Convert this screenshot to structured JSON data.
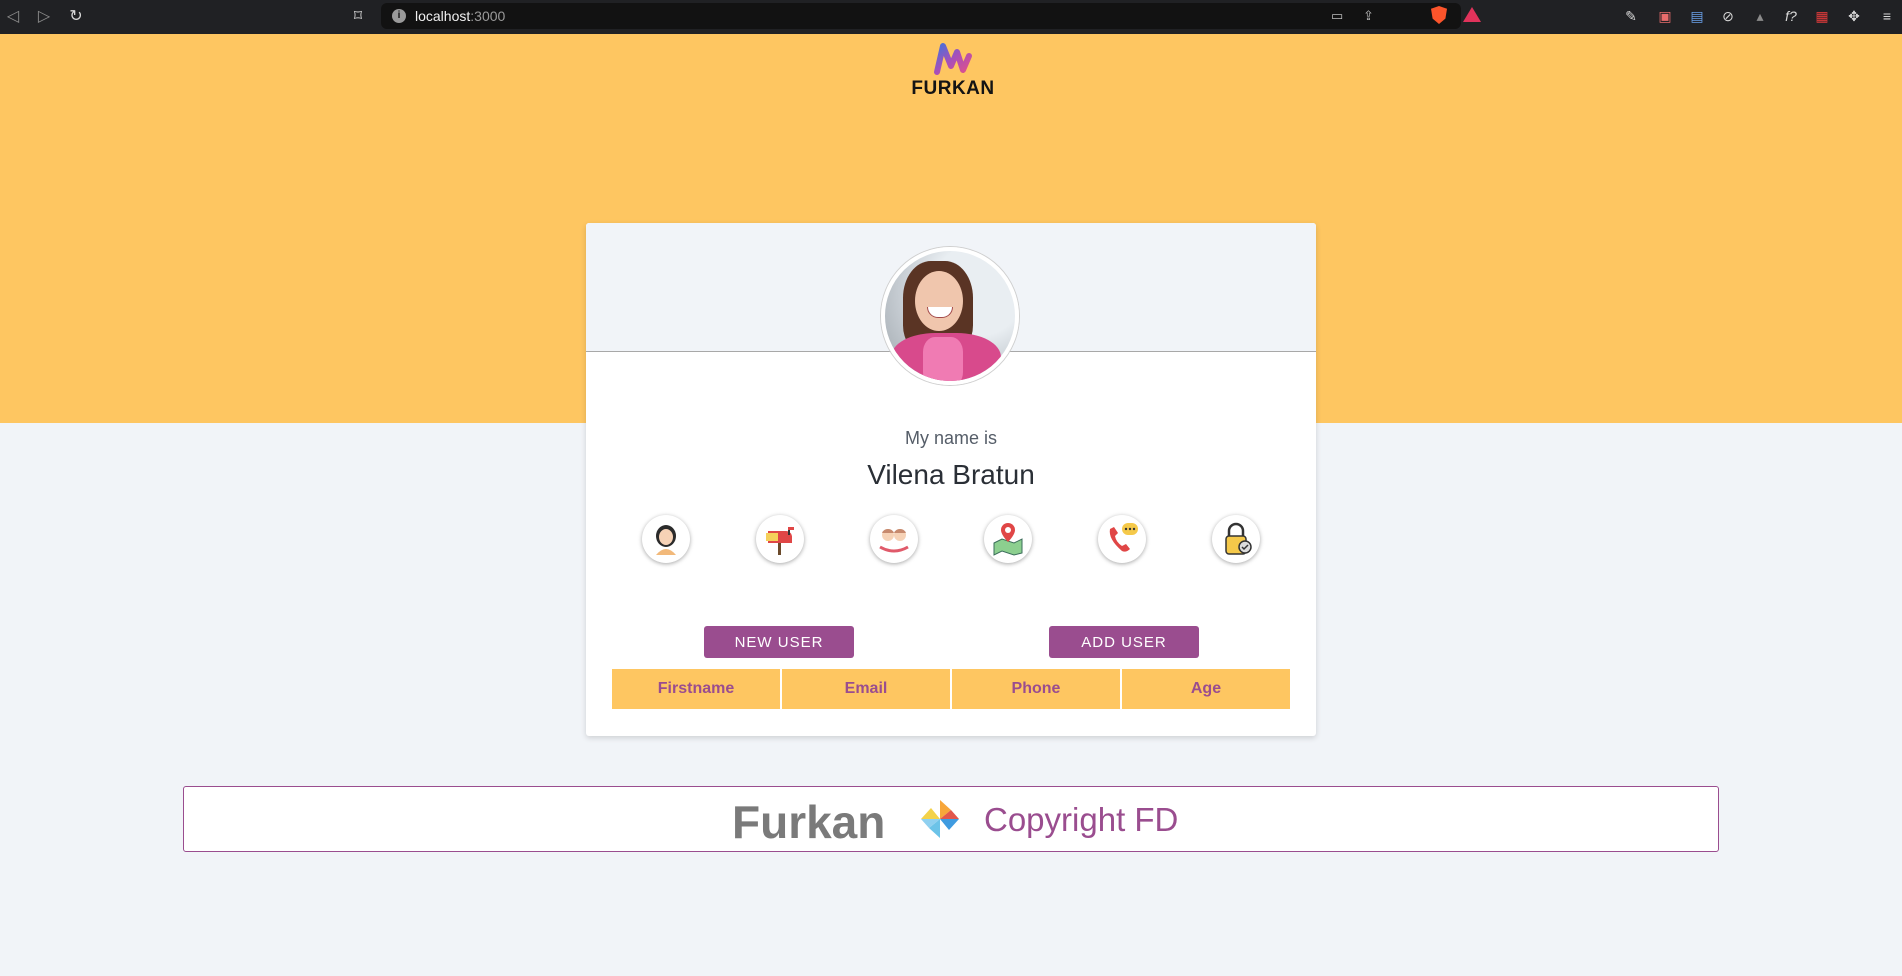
{
  "browser": {
    "url_host": "localhost",
    "url_port": ":3000"
  },
  "header": {
    "logo_text": "FURKAN"
  },
  "profile": {
    "intro": "My name is",
    "name": "Vilena Bratun",
    "info_icons": [
      "user-icon",
      "mailbox-icon",
      "calendar-people-icon",
      "map-pin-icon",
      "phone-icon",
      "lock-icon"
    ]
  },
  "actions": {
    "new_user_label": "NEW USER",
    "add_user_label": "ADD USER"
  },
  "table": {
    "columns": [
      "Firstname",
      "Email",
      "Phone",
      "Age"
    ]
  },
  "footer": {
    "brand": "Furkan",
    "copyright": "Copyright FD"
  },
  "colors": {
    "hero": "#fec661",
    "accent": "#9a4d8f",
    "background": "#f1f4f8"
  }
}
